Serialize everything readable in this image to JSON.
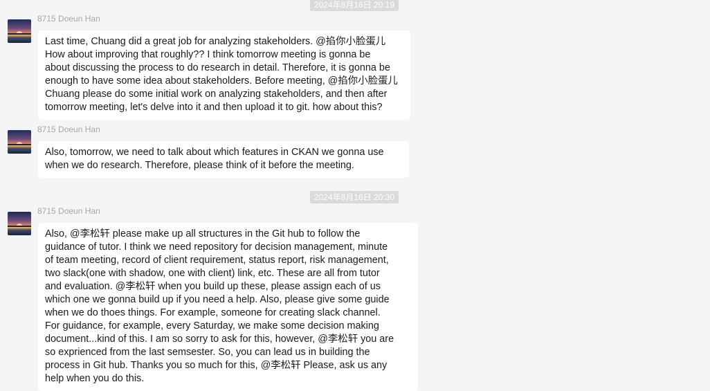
{
  "messages": [
    {
      "timestamp": "2024年8月16日 20:19",
      "sender": "8715 Doeun Han",
      "lines": [
        "Last time, Chuang did a great job for analyzing stakeholders. @掐你小脸蛋儿",
        "How about improving that roughly?? I think tomorrow meeting is gonna be",
        "about discussing the process to do research in detail. Therefore, it is gonna be",
        "enough to have some idea about stakeholders. Before meeting, @掐你小脸蛋儿",
        "Chuang please do some initial work on analyzing stakeholders, and then after",
        "tomorrow meeting, let's delve into it and then upload it to git. how about this?"
      ]
    },
    {
      "sender": "8715 Doeun Han",
      "lines": [
        "Also, tomorrow, we need to talk about which features in CKAN we gonna use",
        "when we do research. Therefore, please think of it before the meeting."
      ]
    },
    {
      "timestamp": "2024年8月16日 20:30",
      "sender": "8715 Doeun Han",
      "lines": [
        "Also, @李松轩 please make up all structures in the Git hub to follow the",
        "guidance of tutor. I think we need repository for decision management, minute",
        "of team meeting, record of client requirement, status report, risk management,",
        "two slack(one with shadow, one with client) link, etc. These are all from tutor",
        "and evaluation. @李松轩 when you build up these, please assign each of us",
        "which one we gonna build up if you need a help. Also, please give some guide",
        "when we do thoes things. For example, someone for creating slack channel.",
        "For guidance, for example, every Saturday, we make some decision making",
        "document...kind of this. I am so sorry to ask for this, however, @李松轩 you are",
        "so exprienced from the last semsester. So, you can lead us in building the",
        "process in Git hub. Thanks you so much for this, @李松轩 Please, ask us any",
        "help when you do this."
      ]
    }
  ]
}
